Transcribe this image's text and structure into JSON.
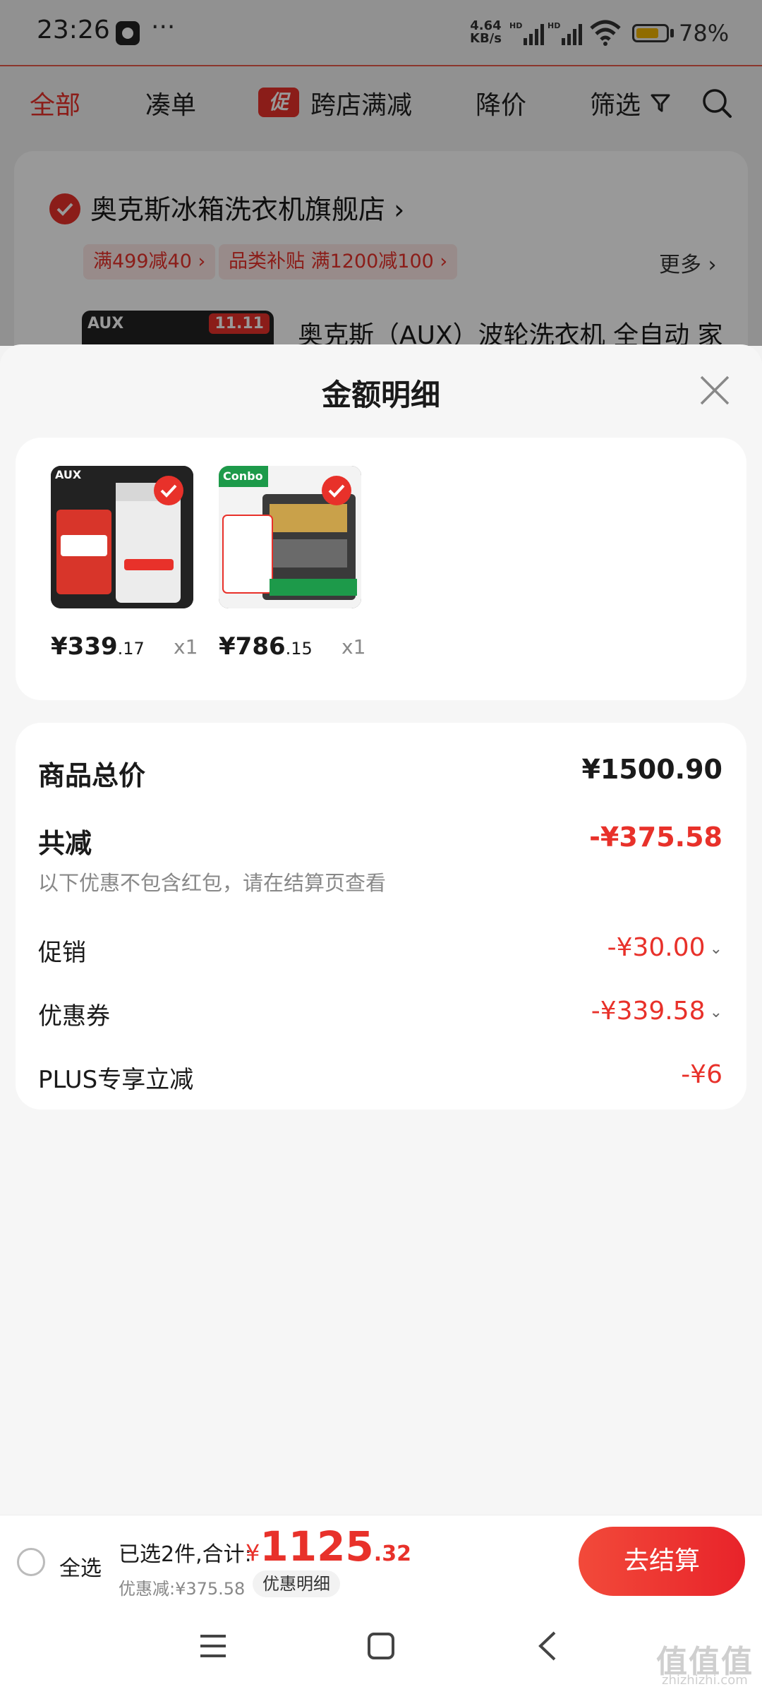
{
  "status_bar": {
    "time": "23:26",
    "dots": "···",
    "net_speed_value": "4.64",
    "net_speed_unit": "KB/s",
    "hd1": "HD",
    "hd2": "HD",
    "battery_percent": 78,
    "battery_text": "78%"
  },
  "nav_tabs": {
    "all": "全部",
    "combine": "凑单",
    "promo_badge": "促",
    "cross_store": "跨店满减",
    "price_drop": "降价",
    "filter": "筛选"
  },
  "store": {
    "name": "奥克斯冰箱洗衣机旗舰店",
    "chevron": "›",
    "chips": [
      "满499减40 ›",
      "品类补贴 满1200减100 ›"
    ],
    "more": "更多 ›",
    "product_title": "奥克斯（AUX）波轮洗衣机 全自动 家",
    "thumb_brand": "AUX",
    "thumb_tag": "11.11"
  },
  "sheet": {
    "title": "金额明细",
    "items": [
      {
        "brand": "AUX",
        "price_int": "¥339",
        "price_dec": ".17",
        "qty": "x1",
        "thumb_color": "#1f1f1f"
      },
      {
        "brand": "Conbo",
        "price_int": "¥786",
        "price_dec": ".15",
        "qty": "x1",
        "thumb_color": "#2b2b2b"
      }
    ],
    "summary": {
      "total_label": "商品总价",
      "total_value": "¥1500.90",
      "reduce_label": "共减",
      "reduce_value": "-¥375.58",
      "note": "以下优惠不包含红包，请在结算页查看",
      "promo_label": "促销",
      "promo_value": "-¥30.00",
      "coupon_label": "优惠券",
      "coupon_value": "-¥339.58",
      "plus_label": "PLUS专享立减",
      "plus_value": "-¥6"
    }
  },
  "bottom_bar": {
    "select_all": "全选",
    "selected_summary": "已选2件,合计:",
    "total_symbol": "¥",
    "total_int": "1125",
    "total_dec": ".32",
    "discount": "优惠减:¥375.58",
    "detail_button": "优惠明细",
    "checkout_button": "去结算"
  },
  "watermark": {
    "main": "值值值",
    "sub": "zhizhizhi.com"
  },
  "colors": {
    "accent": "#e8312a",
    "sheet_bg": "#f6f6f6"
  }
}
